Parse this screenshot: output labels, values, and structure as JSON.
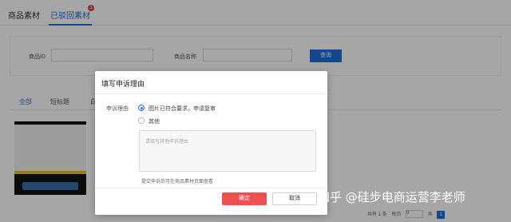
{
  "top_tabs": [
    {
      "label": "商品素材"
    },
    {
      "label": "已驳回素材"
    }
  ],
  "rejected_badge": "1",
  "filter": {
    "product_id_label": "商品ID",
    "product_name_label": "商品名称",
    "search_button": "查询"
  },
  "sub_tabs": [
    {
      "label": "全部"
    },
    {
      "label": "短标题"
    },
    {
      "label": "白"
    }
  ],
  "pager": {
    "total_text": "共有 1 条",
    "per_page_label": "每页",
    "per_page_value": "9",
    "goto_label": "共",
    "current_page": "1"
  },
  "modal": {
    "title": "填写申诉理由",
    "field_label": "申诉理由",
    "options": [
      {
        "label": "图片已符合要求，申请复审",
        "checked": true
      },
      {
        "label": "其他",
        "checked": false
      }
    ],
    "textarea_placeholder": "请填写其他申诉理由",
    "hint": "提交申诉后可在商品素材页面查看",
    "ok_button": "确定",
    "cancel_button": "取消"
  },
  "watermark": "知乎 @硅步电商运营李老师",
  "colors": {
    "accent": "#1f6fd8",
    "primary_button": "#ef5151",
    "badge": "#e64545"
  }
}
